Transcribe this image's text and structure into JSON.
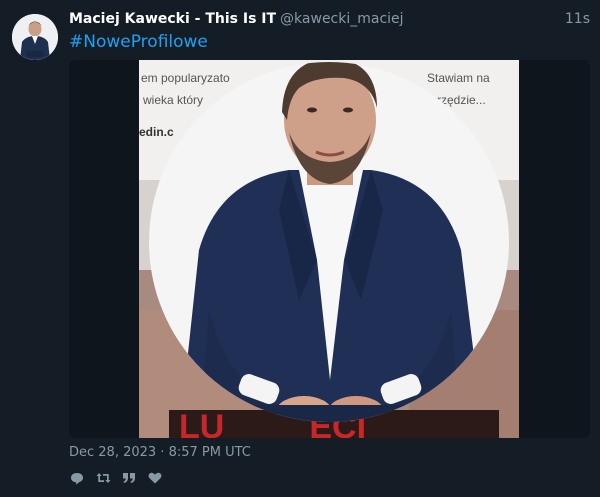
{
  "tweet": {
    "author_name": "Maciej Kawecki - This Is IT",
    "handle": "@kawecki_maciej",
    "time_ago": "11s",
    "text": "#NoweProfilowe",
    "date": "Dec 28, 2023 · 8:57 PM UTC"
  },
  "photo_background_text": {
    "line1": "em popularyzato",
    "line1_right": "Stawiam na",
    "line2": "wieka który",
    "line2_right": "rzędzie...",
    "line3": "edin.c",
    "bottom_banner": "LU         ECI"
  },
  "actions": {
    "reply": "reply-icon",
    "retweet": "retweet-icon",
    "quote": "quote-icon",
    "like": "heart-icon"
  },
  "colors": {
    "background": "#141d26",
    "link": "#1da1f2",
    "muted": "#8899a6",
    "banner_red": "#c8272a"
  }
}
